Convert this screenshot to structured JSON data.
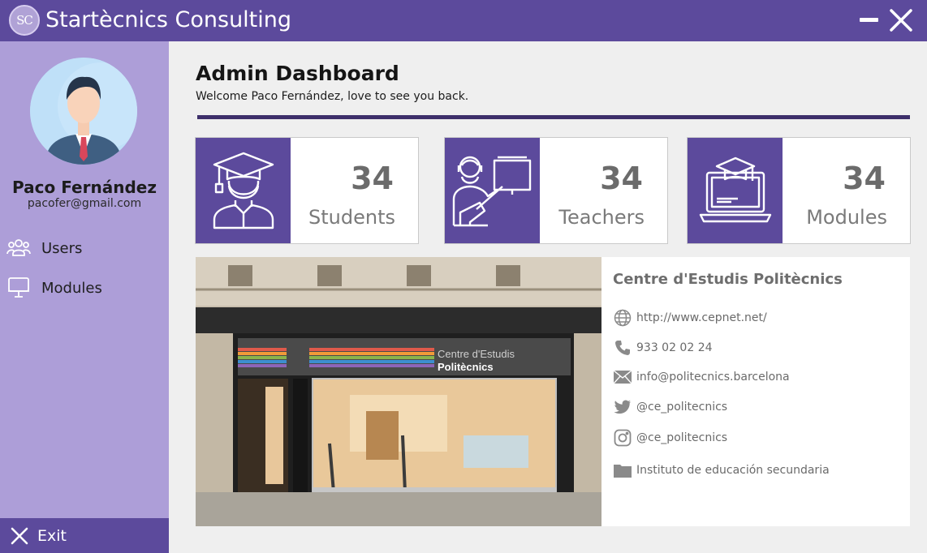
{
  "app": {
    "logo_text": "SC",
    "title": "Startècnics Consulting"
  },
  "user": {
    "name": "Paco Fernández",
    "email": "pacofer@gmail.com"
  },
  "nav": {
    "items": [
      {
        "label": "Users",
        "icon": "users-icon"
      },
      {
        "label": "Modules",
        "icon": "monitor-icon"
      }
    ],
    "exit_label": "Exit"
  },
  "dashboard": {
    "title": "Admin Dashboard",
    "welcome": "Welcome Paco Fernández, love to see you back."
  },
  "stats": [
    {
      "value": "34",
      "label": "Students",
      "icon": "graduate-icon"
    },
    {
      "value": "34",
      "label": "Teachers",
      "icon": "teacher-board-icon"
    },
    {
      "value": "34",
      "label": "Modules",
      "icon": "elearning-laptop-icon"
    }
  ],
  "school": {
    "name": "Centre d'Estudis Politècnics",
    "sign_line1": "Centre d'Estudis",
    "sign_line2": "Politècnics",
    "website": "http://www.cepnet.net/",
    "phone": "933 02 02 24",
    "email": "info@politecnics.barcelona",
    "twitter": "@ce_politecnics",
    "instagram": "@ce_politecnics",
    "category": "Instituto de educación secundaria"
  },
  "colors": {
    "primary": "#5c4a9c",
    "sidebar": "#ad9ed8",
    "divider": "#3d2f6a"
  }
}
